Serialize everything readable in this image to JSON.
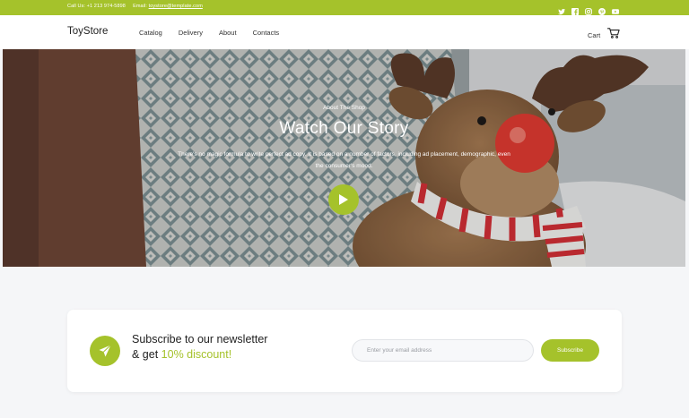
{
  "topbar": {
    "call": "Call Us: +1 213 974-5898",
    "email_label": "Email:",
    "email": "toystore@template.com",
    "social_icons": [
      "twitter-icon",
      "facebook-icon",
      "instagram-icon",
      "pinterest-icon",
      "youtube-icon"
    ]
  },
  "nav": {
    "logo": "ToyStore",
    "items": [
      {
        "label": "Catalog"
      },
      {
        "label": "Delivery"
      },
      {
        "label": "About"
      },
      {
        "label": "Contacts"
      }
    ],
    "cart_label": "Cart",
    "cart_icon": "cart-icon"
  },
  "hero": {
    "eyebrow": "About The Shop",
    "title": "Watch Our Story",
    "description": "There's no magic formula to write perfect ad copy. It is based on a number of factors, including ad placement, demographic, even the consumer's mood.",
    "play_icon": "play-icon"
  },
  "newsletter": {
    "icon": "paper-plane-icon",
    "headline_line1": "Subscribe to our newsletter",
    "headline_prefix": "& get ",
    "headline_accent": "10% discount!",
    "email_placeholder": "Enter your email address",
    "button_label": "Subscribe"
  },
  "colors": {
    "accent": "#a5c22b",
    "text_dark": "#222222",
    "page_bg": "#f5f6f8"
  }
}
